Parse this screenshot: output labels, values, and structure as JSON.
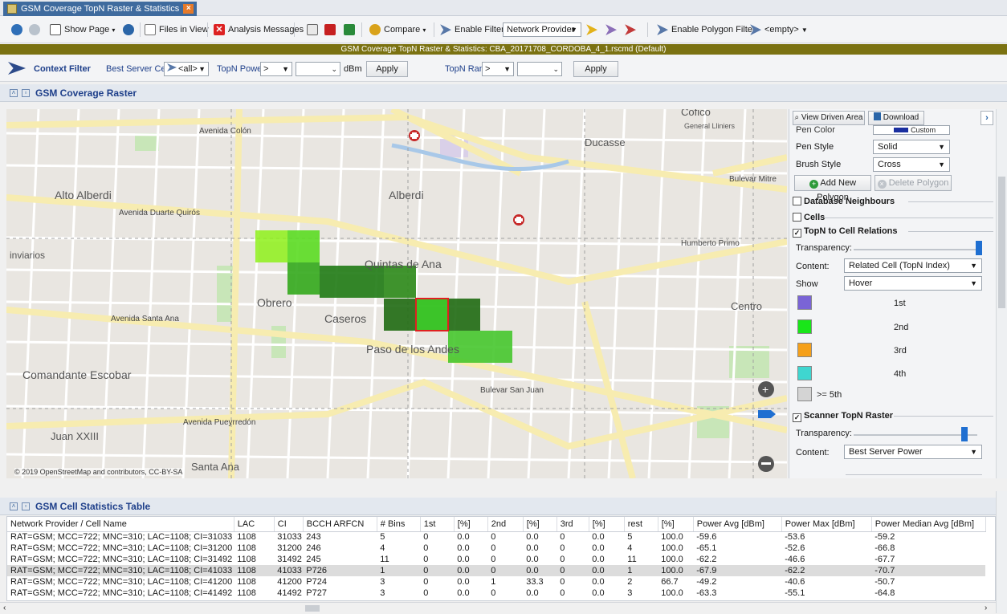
{
  "tab": {
    "title": "GSM Coverage TopN Raster & Statistics",
    "close": "×"
  },
  "toolbar": {
    "show_page": "Show Page",
    "files_in_view": "Files in View",
    "analysis_messages": "Analysis Messages",
    "compare": "Compare",
    "enable_filter": "Enable Filter",
    "network_provider": "Network Provider",
    "enable_polygon_filter": "Enable Polygon Filter",
    "empty": "<empty>"
  },
  "banner": "GSM Coverage TopN Raster & Statistics:  CBA_20171708_CORDOBA_4_1.rscmd (Default)",
  "context_filter": {
    "label": "Context Filter",
    "best_server_cell": "Best Server Cell",
    "all": "<all>",
    "topn_power": "TopN Power",
    "op1": ">",
    "unit": "dBm",
    "apply1": "Apply",
    "topn_rank": "TopN Rank",
    "op2": ">",
    "apply2": "Apply"
  },
  "raster_panel": {
    "title": "GSM Coverage Raster"
  },
  "map": {
    "attribution": "© 2019 OpenStreetMap and contributors, CC-BY-SA",
    "labels": [
      "Alto Alberdi",
      "Alberdi",
      "Quintas de Ana",
      "Obrero",
      "Caseros",
      "Paso de los Andes",
      "Centro",
      "Comandante Escobar",
      "Juan XXIII",
      "Santa Ana",
      "Ducasse",
      "Cofico",
      "General Lliniers",
      "Avenida Colón",
      "Avenida Duarte Quirós",
      "Avenida Santa Ana",
      "Avenida Pueyrredón",
      "Bulevar San Juan",
      "Humberto Primo",
      "Bulevar Mitre",
      "inviarios"
    ]
  },
  "right_panel": {
    "view_driven_area": "View Driven Area",
    "download": "Download",
    "pen_color": "Pen Color",
    "custom": "Custom",
    "pen_style": "Pen Style",
    "pen_style_value": "Solid",
    "brush_style": "Brush Style",
    "brush_style_value": "Cross",
    "add_new_polygon": "Add New Polygon",
    "delete_polygon": "Delete Polygon",
    "database_neighbours": "Database Neighbours",
    "cells": "Cells",
    "topn_to_cell": "TopN to Cell Relations",
    "transparency": "Transparency:",
    "content": "Content:",
    "content_value": "Related Cell (TopN Index)",
    "show": "Show",
    "show_value": "Hover",
    "legend": [
      {
        "label": "1st",
        "color": "#7a64d6"
      },
      {
        "label": "2nd",
        "color": "#19e619"
      },
      {
        "label": "3rd",
        "color": "#f5a01a"
      },
      {
        "label": "4th",
        "color": "#3fd6d0"
      },
      {
        "label": ">= 5th",
        "color": "#d4d4d4"
      }
    ],
    "scanner_topn": "Scanner TopN Raster",
    "transparency2": "Transparency:",
    "content2": "Content:",
    "content2_value": "Best Server Power"
  },
  "stats_panel": {
    "title": "GSM Cell Statistics Table"
  },
  "table": {
    "headers": [
      "Network Provider / Cell Name",
      "LAC",
      "CI",
      "BCCH ARFCN",
      "# Bins",
      "1st",
      "[%]",
      "2nd",
      "[%]",
      "3rd",
      "[%]",
      "rest",
      "[%]",
      "Power Avg [dBm]",
      "Power Max [dBm]",
      "Power Median Avg [dBm]"
    ],
    "rows": [
      [
        "RAT=GSM; MCC=722; MNC=310; LAC=1108; CI=31033",
        "1108",
        "31033",
        "243",
        "5",
        "0",
        "0.0",
        "0",
        "0.0",
        "0",
        "0.0",
        "5",
        "100.0",
        "-59.6",
        "-53.6",
        "-59.2"
      ],
      [
        "RAT=GSM; MCC=722; MNC=310; LAC=1108; CI=31200",
        "1108",
        "31200",
        "246",
        "4",
        "0",
        "0.0",
        "0",
        "0.0",
        "0",
        "0.0",
        "4",
        "100.0",
        "-65.1",
        "-52.6",
        "-66.8"
      ],
      [
        "RAT=GSM; MCC=722; MNC=310; LAC=1108; CI=31492",
        "1108",
        "31492",
        "245",
        "11",
        "0",
        "0.0",
        "0",
        "0.0",
        "0",
        "0.0",
        "11",
        "100.0",
        "-62.2",
        "-46.6",
        "-67.7"
      ],
      [
        "RAT=GSM; MCC=722; MNC=310; LAC=1108; CI=41033",
        "1108",
        "41033",
        "P726",
        "1",
        "0",
        "0.0",
        "0",
        "0.0",
        "0",
        "0.0",
        "1",
        "100.0",
        "-67.9",
        "-62.2",
        "-70.7"
      ],
      [
        "RAT=GSM; MCC=722; MNC=310; LAC=1108; CI=41200",
        "1108",
        "41200",
        "P724",
        "3",
        "0",
        "0.0",
        "1",
        "33.3",
        "0",
        "0.0",
        "2",
        "66.7",
        "-49.2",
        "-40.6",
        "-50.7"
      ],
      [
        "RAT=GSM; MCC=722; MNC=310; LAC=1108; CI=41492",
        "1108",
        "41492",
        "P727",
        "3",
        "0",
        "0.0",
        "0",
        "0.0",
        "0",
        "0.0",
        "3",
        "100.0",
        "-63.3",
        "-55.1",
        "-64.8"
      ]
    ],
    "selected_row": 3
  }
}
